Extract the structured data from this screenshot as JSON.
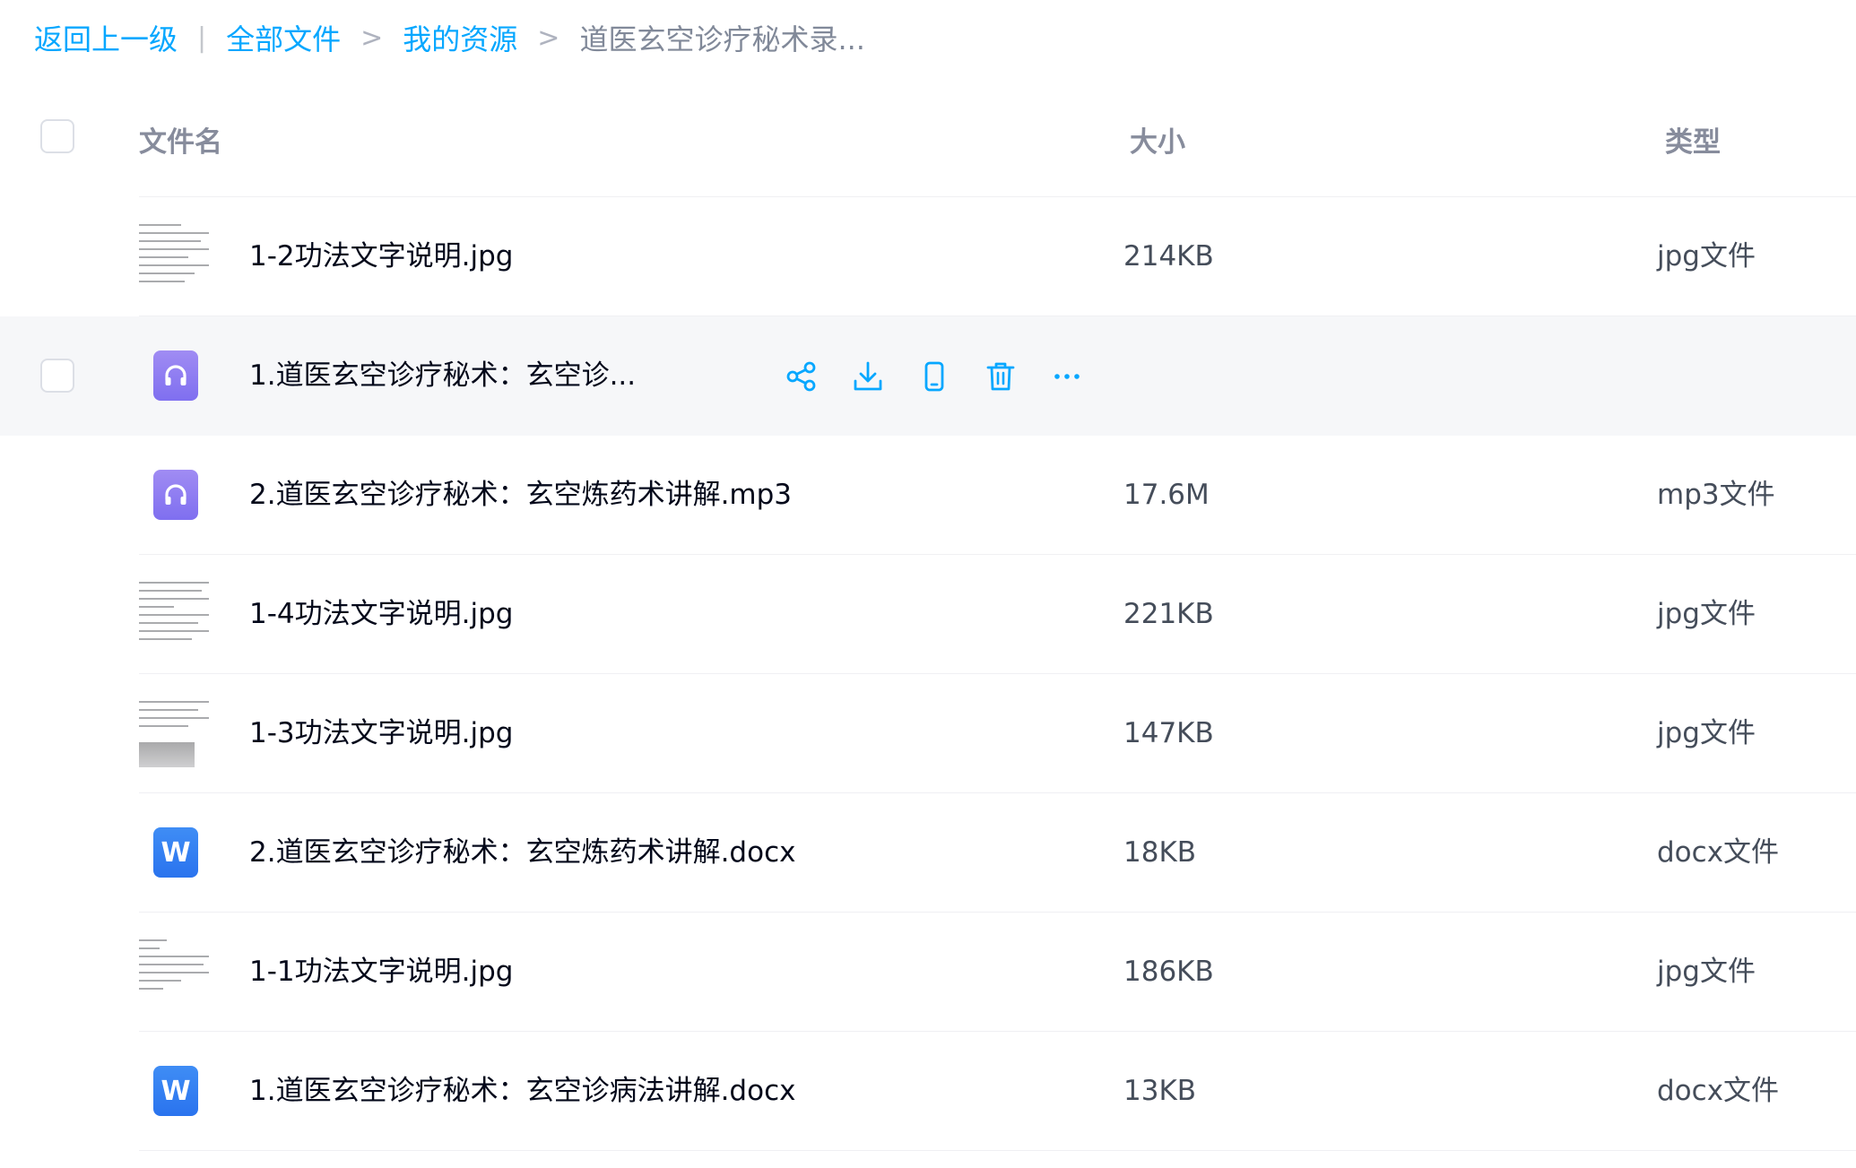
{
  "breadcrumb": {
    "back": "返回上一级",
    "sep_bar": "|",
    "all_files": "全部文件",
    "sep1": ">",
    "my_resources": "我的资源",
    "sep2": ">",
    "current": "道医玄空诊疗秘术录..."
  },
  "columns": {
    "name": "文件名",
    "size": "大小",
    "type": "类型"
  },
  "files": [
    {
      "name": "1-2功法文字说明.jpg",
      "size": "214KB",
      "type": "jpg文件",
      "icon": "image-thumbnail"
    },
    {
      "name": "1.道医玄空诊疗秘术：玄空诊...",
      "size": "",
      "type": "",
      "icon": "audio-icon"
    },
    {
      "name": "2.道医玄空诊疗秘术：玄空炼药术讲解.mp3",
      "size": "17.6M",
      "type": "mp3文件",
      "icon": "audio-icon"
    },
    {
      "name": "1-4功法文字说明.jpg",
      "size": "221KB",
      "type": "jpg文件",
      "icon": "image-thumbnail"
    },
    {
      "name": "1-3功法文字说明.jpg",
      "size": "147KB",
      "type": "jpg文件",
      "icon": "image-thumbnail"
    },
    {
      "name": "2.道医玄空诊疗秘术：玄空炼药术讲解.docx",
      "size": "18KB",
      "type": "docx文件",
      "icon": "word-icon"
    },
    {
      "name": "1-1功法文字说明.jpg",
      "size": "186KB",
      "type": "jpg文件",
      "icon": "image-thumbnail"
    },
    {
      "name": "1.道医玄空诊疗秘术：玄空诊病法讲解.docx",
      "size": "13KB",
      "type": "docx文件",
      "icon": "word-icon"
    }
  ],
  "row_actions": [
    "share-icon",
    "download-icon",
    "phone-icon",
    "delete-icon",
    "more-icon"
  ],
  "colors": {
    "accent": "#06a7ff",
    "hover_row": "#f6f7f9",
    "audio_icon": "#8f7df2",
    "word_icon": "#2f7cf1"
  }
}
